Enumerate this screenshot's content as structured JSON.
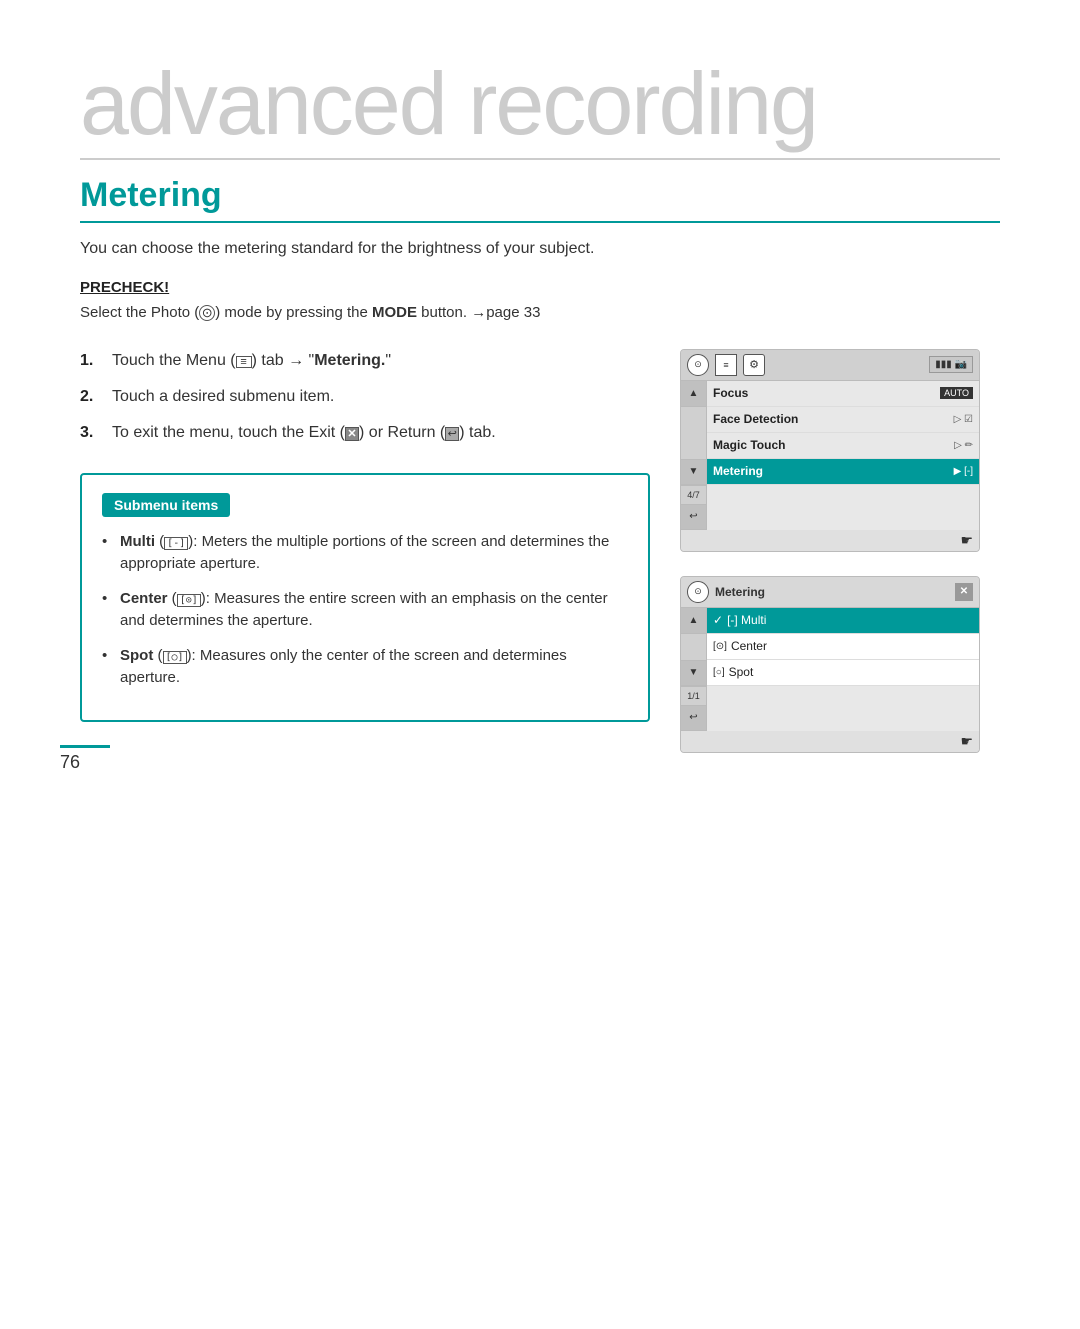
{
  "page": {
    "number": "76",
    "title": "advanced recording",
    "section": "Metering",
    "description": "You can choose the metering standard for the brightness of your subject.",
    "precheck": {
      "label": "PRECHECK!",
      "text": "Select the Photo (",
      "icon_desc": "photo-mode-icon",
      "text2": ") mode by pressing the ",
      "bold": "MODE",
      "text3": " button. ",
      "pageref": "→page 33"
    },
    "steps": [
      {
        "number": "1.",
        "text": "Touch the Menu (",
        "icon_desc": "menu-icon",
        "text2": ") tab → \"Metering.\""
      },
      {
        "number": "2.",
        "text": "Touch a desired submenu item."
      },
      {
        "number": "3.",
        "text": "To exit the menu, touch the Exit (",
        "exit_icon": "X",
        "text2": ") or Return (",
        "return_icon": "↩",
        "text3": ") tab."
      }
    ],
    "submenu": {
      "title": "Submenu items",
      "items": [
        {
          "label": "Multi",
          "icon": "[ - ]",
          "description": "Meters the multiple portions of the screen and determines the appropriate aperture."
        },
        {
          "label": "Center",
          "icon": "[ ⊙ ]",
          "description": "Measures the entire screen with an emphasis on the center and determines the aperture."
        },
        {
          "label": "Spot",
          "icon": "[ ○ ]",
          "description": "Measures only the center of the screen and determines aperture."
        }
      ]
    },
    "screen1": {
      "icons": [
        "photo",
        "list",
        "gear",
        "battery"
      ],
      "rows": [
        {
          "label": "Focus",
          "value": "AUTO",
          "page": ""
        },
        {
          "label": "Face Detection",
          "value": "▷ ☑",
          "page": ""
        },
        {
          "label": "Magic Touch",
          "value": "▷ ✏",
          "page": "4/7"
        },
        {
          "label": "Metering",
          "value": "▶ [-]",
          "highlighted": true
        }
      ]
    },
    "screen2": {
      "title": "Metering",
      "items": [
        {
          "label": "[-] Multi",
          "selected": true
        },
        {
          "label": "[⊙] Center",
          "selected": false
        },
        {
          "label": "[○] Spot",
          "selected": false
        }
      ],
      "page": "1/1"
    }
  }
}
